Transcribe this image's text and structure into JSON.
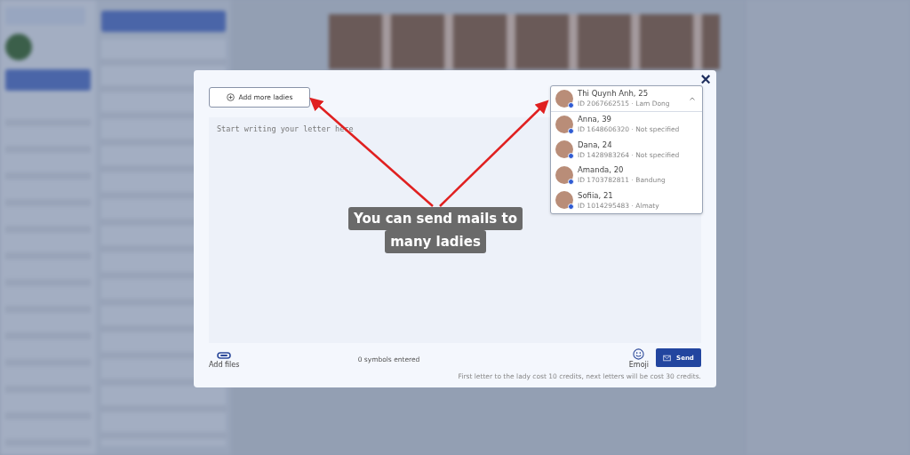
{
  "modal": {
    "add_button": "Add more ladies",
    "letter_placeholder": "Start writing your letter here",
    "close": "×",
    "recipients": {
      "expanded": true,
      "chosen": {
        "name": "Thi Quynh Anh, 25",
        "details": "ID 2067662515 · Lam Dong",
        "online": true
      },
      "options": [
        {
          "name": "Anna, 39",
          "details": "ID 1648606320 · Not specified",
          "online": true
        },
        {
          "name": "Dana, 24",
          "details": "ID 1428983264 · Not specified",
          "online": true
        },
        {
          "name": "Amanda, 20",
          "details": "ID 1703782811 · Bandung",
          "online": true
        },
        {
          "name": "Sofiia, 21",
          "details": "ID 1014295483 · Almaty",
          "online": true
        }
      ]
    },
    "add_files": "Add files",
    "counter": "0 symbols entered",
    "emoji": "Emoji",
    "send": "Send",
    "note": "First letter to the lady cost 10 credits, next letters will be cost 30 credits."
  },
  "callout_lines": [
    "You can send mails to",
    "many ladies"
  ]
}
